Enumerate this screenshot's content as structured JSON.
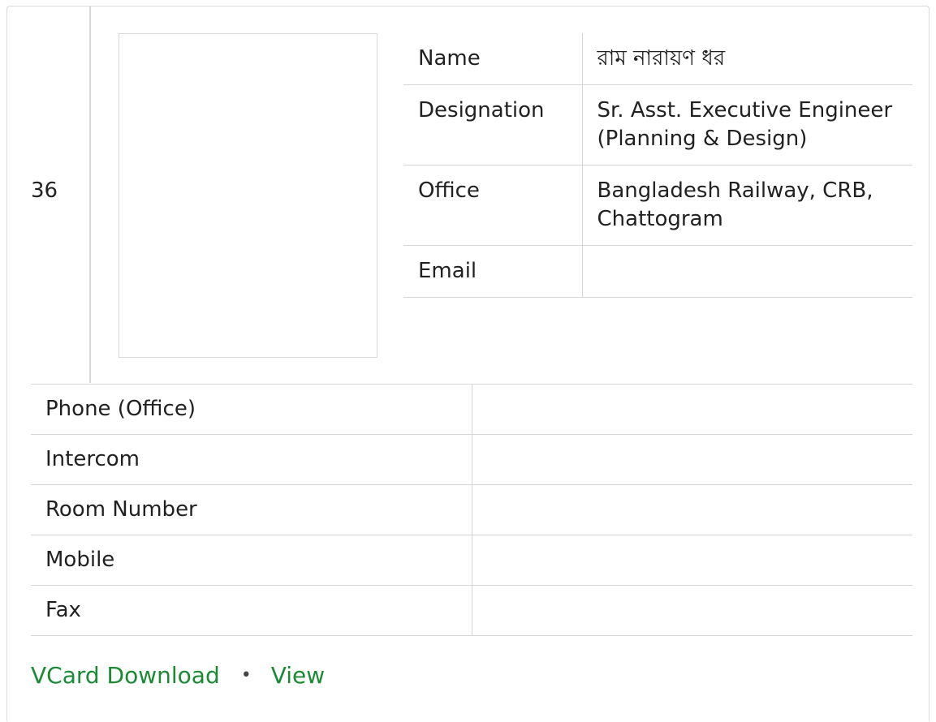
{
  "employee": {
    "serial": "36",
    "name_label": "Name",
    "name_value": "রাম নারায়ণ ধর",
    "designation_label": "Designation",
    "designation_value": "Sr. Asst. Executive Engineer (Planning & Design)",
    "office_label": "Office",
    "office_value": "Bangladesh Railway, CRB, Chattogram",
    "email_label": "Email",
    "email_value": ""
  },
  "contact": {
    "rows": [
      {
        "label": "Phone (Office)",
        "value": ""
      },
      {
        "label": "Intercom",
        "value": ""
      },
      {
        "label": "Room Number",
        "value": ""
      },
      {
        "label": "Mobile",
        "value": ""
      },
      {
        "label": "Fax",
        "value": ""
      }
    ]
  },
  "links": {
    "vcard_label": "VCard Download",
    "separator": "•",
    "view_label": "View",
    "color": "#1a8a35"
  }
}
